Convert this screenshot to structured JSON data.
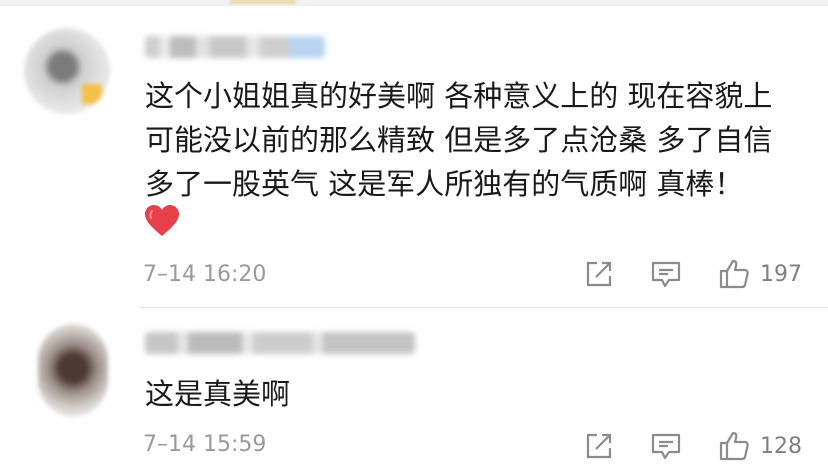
{
  "comments": [
    {
      "text": "这个小姐姐真的好美啊 各种意义上的 现在容貌上\n可能没以前的那么精致 但是多了点沧桑 多了自信\n多了一股英气 这是军人所独有的气质啊 真棒！",
      "emoji": "red-heart",
      "time": "7–14 16:20",
      "likes": "197"
    },
    {
      "text": "这是真美啊",
      "time": "7–14 15:59",
      "likes": "128"
    }
  ],
  "colors": {
    "text": "#1a1a1a",
    "meta": "#9a9a9a",
    "heart": "#e8404a"
  }
}
